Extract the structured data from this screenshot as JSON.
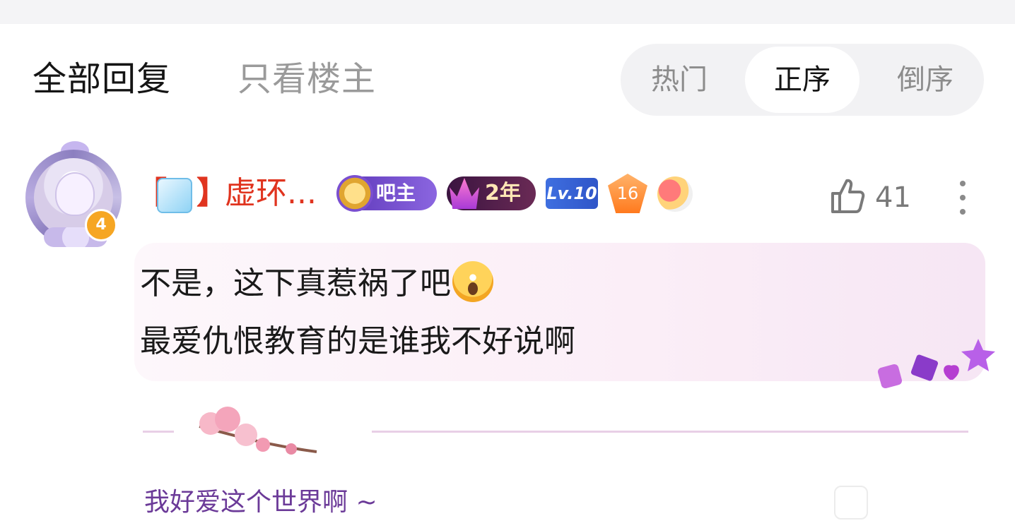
{
  "filter_tabs": {
    "all": "全部回复",
    "owner_only": "只看楼主"
  },
  "sort": {
    "hot": "热门",
    "asc": "正序",
    "desc": "倒序",
    "selected": "正序"
  },
  "post": {
    "avatar": {
      "level": "4"
    },
    "username": {
      "left_bracket": "【",
      "right_bracket": "】",
      "name": "虚环...",
      "icon": "ice-cube-icon"
    },
    "badges": {
      "owner": "吧主",
      "years": "2年",
      "level": "Lv.10",
      "rank": "16",
      "emoji": "heart-face-icon"
    },
    "likes": "41",
    "content": {
      "line1": "不是，这下真惹祸了吧",
      "line1_emoji": "scream-emoji",
      "line2": "最爱仇恨教育的是谁我不好说啊"
    },
    "signature": "我好爱这个世界啊 ~"
  },
  "colors": {
    "username": "#e0341f",
    "signature": "#6b3a98",
    "owner_badge": "#6a43c8"
  }
}
